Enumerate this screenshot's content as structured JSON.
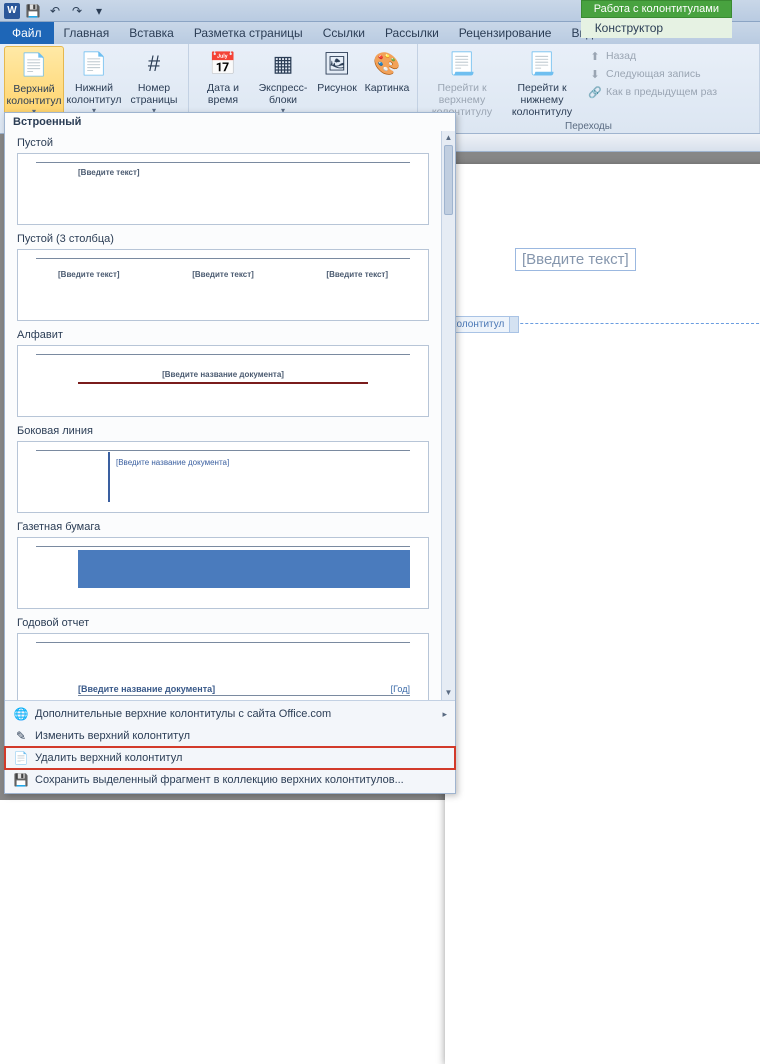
{
  "titlebar": {
    "app_icon": "W"
  },
  "tabs": {
    "file": "Файл",
    "home": "Главная",
    "insert": "Вставка",
    "layout": "Разметка страницы",
    "refs": "Ссылки",
    "mail": "Рассылки",
    "review": "Рецензирование",
    "view": "Вид",
    "contextHeader": "Работа с колонтитулами",
    "contextTab": "Конструктор"
  },
  "ribbon": {
    "header": "Верхний колонтитул",
    "footer": "Нижний колонтитул",
    "pagenum": "Номер страницы",
    "datetime": "Дата и время",
    "quick": "Экспресс-блоки",
    "picture": "Рисунок",
    "clipart": "Картинка",
    "gotoHeader": "Перейти к верхнему колонтитулу",
    "gotoFooter": "Перейти к нижнему колонтитулу",
    "navGroup": "Переходы",
    "back": "Назад",
    "next": "Следующая запись",
    "asPrev": "Как в предыдущем раз"
  },
  "gallery": {
    "builtin": "Встроенный",
    "empty": "Пустой",
    "empty3": "Пустой (3 столбца)",
    "alphabet": "Алфавит",
    "sideline": "Боковая линия",
    "newspaper": "Газетная бумага",
    "annual": "Годовой отчет",
    "ph_text": "[Введите текст]",
    "ph_doc": "[Введите название документа]",
    "ph_year": "[Год]",
    "cmd_more": "Дополнительные верхние колонтитулы с сайта Office.com",
    "cmd_edit": "Изменить верхний колонтитул",
    "cmd_remove": "Удалить верхний колонтитул",
    "cmd_save": "Сохранить выделенный фрагмент в коллекцию верхних колонтитулов..."
  },
  "page": {
    "placeholder": "[Введите текст]",
    "badge": "колонтитул"
  }
}
